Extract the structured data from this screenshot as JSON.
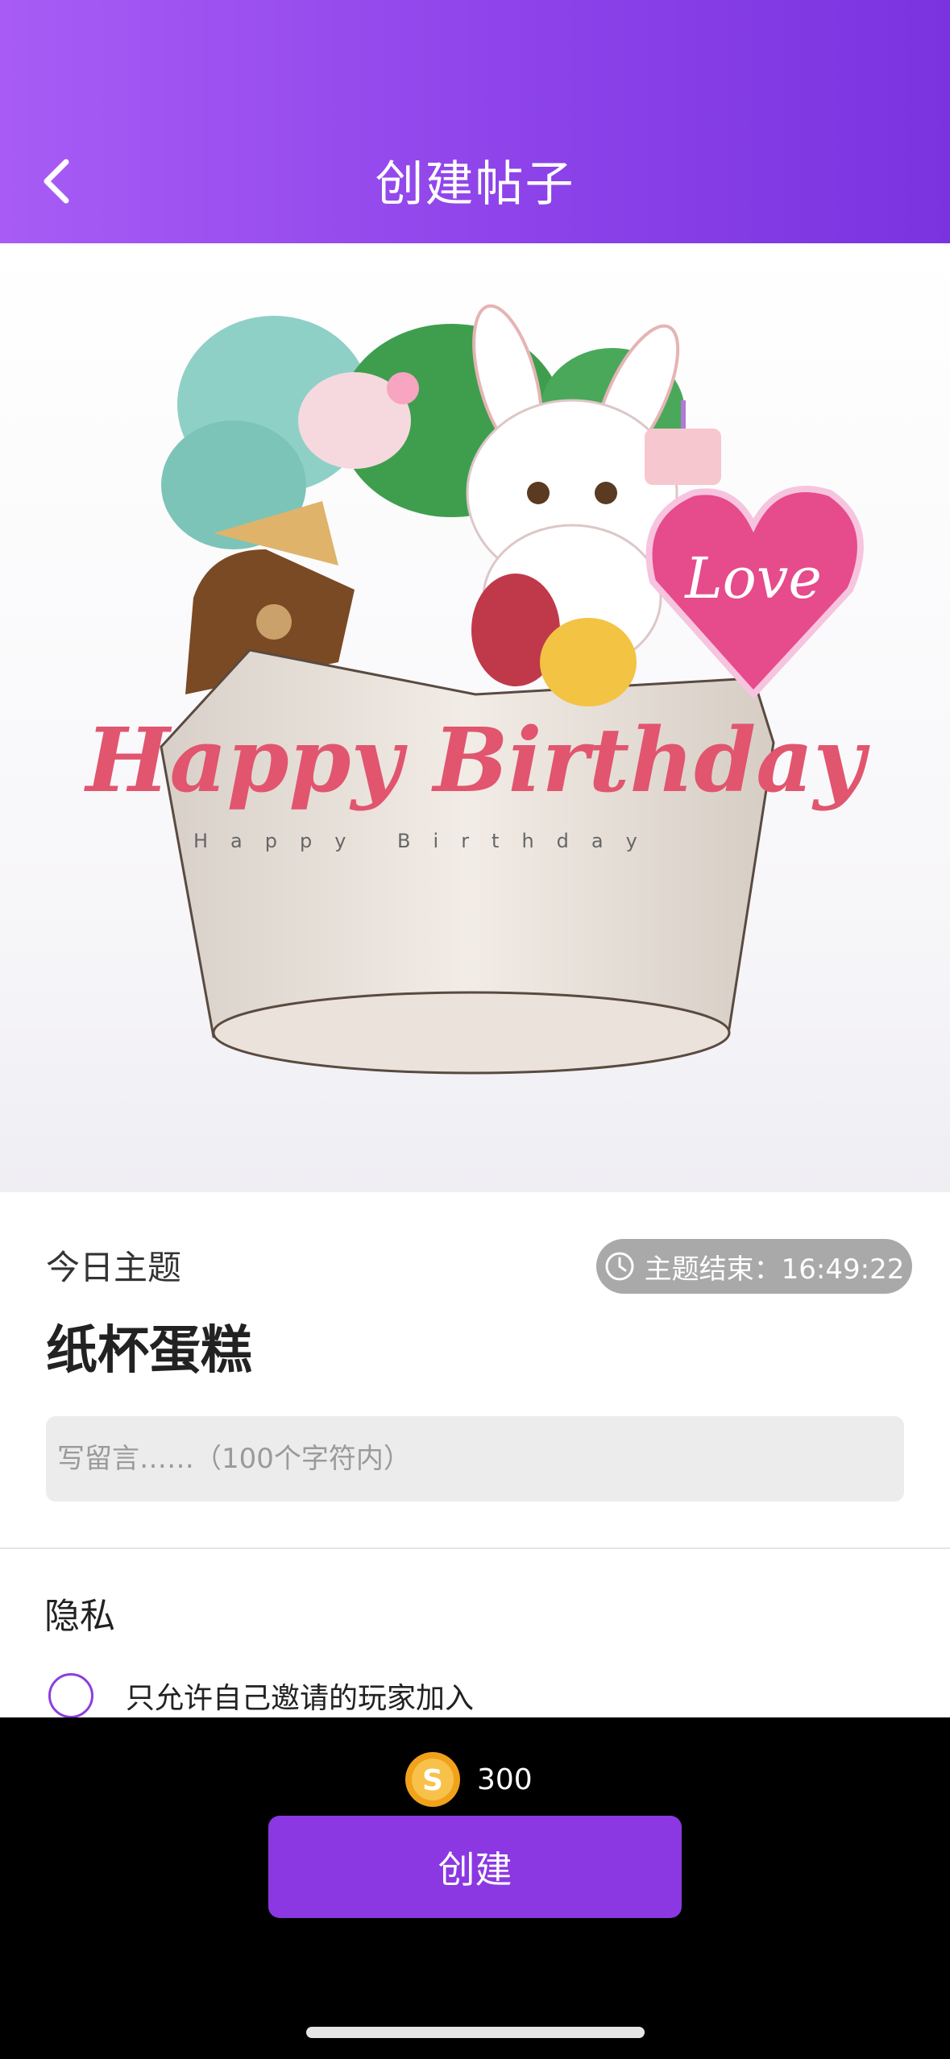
{
  "header": {
    "title": "创建帖子"
  },
  "hero": {
    "cake_text_main": "Happy Birthday",
    "cake_text_small": "Happy Birthday",
    "topper_text": "Love"
  },
  "theme": {
    "label": "今日主题",
    "timer_prefix": "主题结束：",
    "timer_value": "16:49:22",
    "title": "纸杯蛋糕"
  },
  "message": {
    "placeholder": "写留言……（100个字符内）"
  },
  "privacy": {
    "label": "隐私",
    "option_label": "只允许自己邀请的玩家加入",
    "option_checked": false
  },
  "footer": {
    "cost": "300",
    "create_label": "创建"
  },
  "colors": {
    "header_gradient_start": "#a85cf5",
    "header_gradient_end": "#7a33e0",
    "accent": "#8b38e2",
    "timer_badge": "#a9a9a9"
  }
}
